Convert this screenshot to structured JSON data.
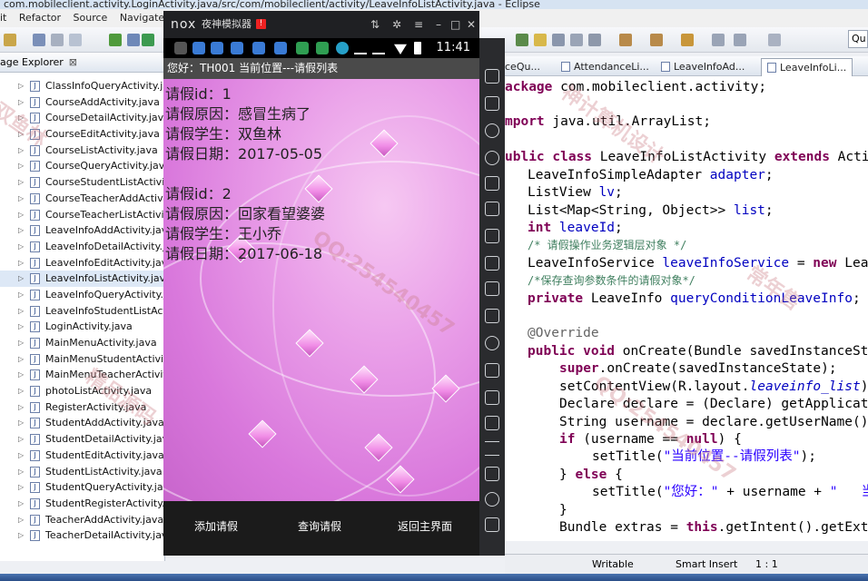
{
  "eclipse": {
    "title": "com.mobileclient.activity.LoginActivity.java/src/com/mobileclient/activity/LeaveInfoListActivity.java - Eclipse",
    "menus": [
      "it",
      "Refactor",
      "Source",
      "Navigate"
    ],
    "quick_access": "Qu"
  },
  "package_explorer": {
    "tab_label": "age Explorer",
    "close": "⊠",
    "files": [
      "ClassInfoQueryActivity.java",
      "CourseAddActivity.java",
      "CourseDetailActivity.java",
      "CourseEditActivity.java",
      "CourseListActivity.java",
      "CourseQueryActivity.java",
      "CourseStudentListActivity.",
      "CourseTeacherAddActivity",
      "CourseTeacherListActivity.",
      "LeaveInfoAddActivity.java",
      "LeaveInfoDetailActivity.jav",
      "LeaveInfoEditActivity.java",
      "LeaveInfoListActivity.java",
      "LeaveInfoQueryActivity.jav",
      "LeaveInfoStudentListActivi",
      "LoginActivity.java",
      "MainMenuActivity.java",
      "MainMenuStudentActivity.",
      "MainMenuTeacherActivity",
      "photoListActivity.java",
      "RegisterActivity.java",
      "StudentAddActivity.java",
      "StudentDetailActivity.java",
      "StudentEditActivity.java",
      "StudentListActivity.java",
      "StudentQueryActivity.java",
      "StudentRegisterActivity.jav",
      "TeacherAddActivity.java",
      "TeacherDetailActivity.java"
    ],
    "selected_index": 12
  },
  "editor": {
    "tabs": [
      "ceQu...",
      "AttendanceLi...",
      "LeaveInfoAd...",
      "LeaveInfoLi..."
    ],
    "active_tab": 3,
    "code": {
      "l1_kw": "ackage",
      "l1_rest": " com.mobileclient.activity;",
      "l2_kw": "mport",
      "l2_rest": " java.util.ArrayList;",
      "l3_kw1": "ublic",
      "l3_kw2": "class",
      "l3_name": " LeaveInfoListActivity ",
      "l3_kw3": "extends",
      "l3_rest": " Acti",
      "l4_type": "LeaveInfoSimpleAdapter ",
      "l4_fld": "adapter",
      "l4_end": ";",
      "l5_type": "ListView ",
      "l5_fld": "lv",
      "l5_end": ";",
      "l6_type": "List<Map<String, Object>> ",
      "l6_fld": "list",
      "l6_end": ";",
      "l7_kw": "int",
      "l7_fld": " leaveId",
      "l7_end": ";",
      "l8_cmt": "/* 请假操作业务逻辑层对象 */",
      "l9_type": "LeaveInfoService ",
      "l9_fld": "leaveInfoService",
      "l9_mid": " = ",
      "l9_kw": "new",
      "l9_rest": " Lea",
      "l10_cmt": "/*保存查询参数条件的请假对象*/",
      "l11_kw": "private",
      "l11_type": " LeaveInfo ",
      "l11_fld": "queryConditionLeaveInfo",
      "l11_end": ";",
      "l12_ann": "@Override",
      "l13_kw1": "public",
      "l13_kw2": " void",
      "l13_rest": " onCreate(Bundle savedInstanceSt",
      "l14_kw": "super",
      "l14_rest": ".onCreate(savedInstanceState);",
      "l15_a": "setContentView(R.layout.",
      "l15_it": "leaveinfo_list",
      "l15_b": ")",
      "l16": "Declare declare = (Declare) getApplicat",
      "l17": "String username = declare.getUserName()",
      "l18_kw1": "if",
      "l18_a": " (username == ",
      "l18_kw2": "null",
      "l18_b": ") {",
      "l19_a": "setTitle(",
      "l19_str": "\"当前位置--请假列表\"",
      "l19_b": ");",
      "l20_a": "} ",
      "l20_kw": "else",
      "l20_b": " {",
      "l21_a": "setTitle(",
      "l21_str": "\"您好：\"",
      "l21_b": " + username + ",
      "l21_str2": "\"   当",
      "l22": "}",
      "l23_a": "Bundle extras = ",
      "l23_kw": "this",
      "l23_b": ".getIntent().getExt"
    }
  },
  "status": {
    "writable": "Writable",
    "insert": "Smart Insert",
    "pos": "1 : 1"
  },
  "emulator": {
    "logo": "nox",
    "name": "夜神模拟器",
    "badge": "!",
    "time": "11:41",
    "app_title": "您好：TH001  当前位置---请假列表",
    "records": [
      {
        "id_label": "请假id：",
        "id": "1",
        "reason_label": "请假原因：",
        "reason": "感冒生病了",
        "student_label": "请假学生：",
        "student": "双鱼林",
        "date_label": "请假日期：",
        "date": "2017-05-05"
      },
      {
        "id_label": "请假id：",
        "id": "2",
        "reason_label": "请假原因：",
        "reason": "回家看望婆婆",
        "student_label": "请假学生：",
        "student": "王小乔",
        "date_label": "请假日期：",
        "date": "2017-06-18"
      }
    ],
    "buttons": {
      "add": "添加请假",
      "query": "查询请假",
      "back": "返回主界面"
    }
  },
  "colors": {
    "keyword": "#7f0055",
    "field": "#0000c0",
    "string": "#2a00ff",
    "comment": "#3f7f5f",
    "app_bg": "#e99ee8"
  }
}
